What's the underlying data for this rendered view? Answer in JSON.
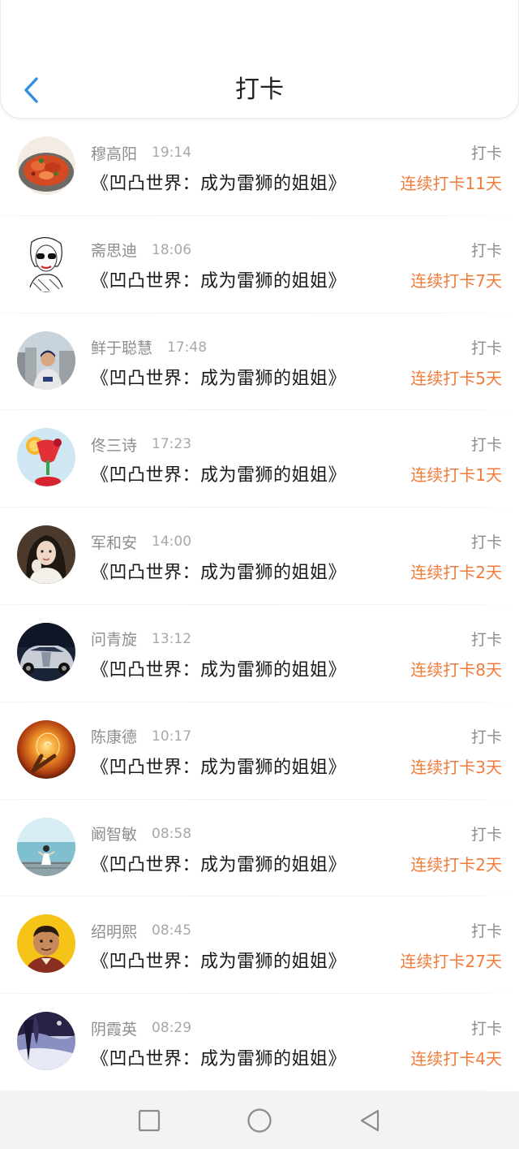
{
  "header": {
    "title": "打卡"
  },
  "icons": {
    "back": "chevron-left-icon",
    "nav_recent": "square-icon",
    "nav_home": "circle-icon",
    "nav_back": "triangle-back-icon"
  },
  "colors": {
    "accent_blue": "#2f8fe6",
    "streak_orange": "#f07b3a",
    "muted_text": "#8d8d8d",
    "title_text": "#1a1a1a"
  },
  "items": [
    {
      "name": "穆高阳",
      "time": "19:14",
      "title": "《凹凸世界：成为雷狮的姐姐》",
      "action": "打卡",
      "streak": "连续打卡11天",
      "avatar": "food-dish"
    },
    {
      "name": "斋思迪",
      "time": "18:06",
      "title": "《凹凸世界：成为雷狮的姐姐》",
      "action": "打卡",
      "streak": "连续打卡7天",
      "avatar": "sketch-girl"
    },
    {
      "name": "鲜于聪慧",
      "time": "17:48",
      "title": "《凹凸世界：成为雷狮的姐姐》",
      "action": "打卡",
      "streak": "连续打卡5天",
      "avatar": "man-city"
    },
    {
      "name": "佟三诗",
      "time": "17:23",
      "title": "《凹凸世界：成为雷狮的姐姐》",
      "action": "打卡",
      "streak": "连续打卡1天",
      "avatar": "cocktail"
    },
    {
      "name": "军和安",
      "time": "14:00",
      "title": "《凹凸世界：成为雷狮的姐姐》",
      "action": "打卡",
      "streak": "连续打卡2天",
      "avatar": "woman-portrait"
    },
    {
      "name": "问青旋",
      "time": "13:12",
      "title": "《凹凸世界：成为雷狮的姐姐》",
      "action": "打卡",
      "streak": "连续打卡8天",
      "avatar": "car"
    },
    {
      "name": "陈康德",
      "time": "10:17",
      "title": "《凹凸世界：成为雷狮的姐姐》",
      "action": "打卡",
      "streak": "连续打卡3天",
      "avatar": "light-bulb"
    },
    {
      "name": "阚智敏",
      "time": "08:58",
      "title": "《凹凸世界：成为雷狮的姐姐》",
      "action": "打卡",
      "streak": "连续打卡2天",
      "avatar": "seaside-girl"
    },
    {
      "name": "绍明熙",
      "time": "08:45",
      "title": "《凹凸世界：成为雷狮的姐姐》",
      "action": "打卡",
      "streak": "连续打卡27天",
      "avatar": "cartoon-man"
    },
    {
      "name": "阴霞英",
      "time": "08:29",
      "title": "《凹凸世界：成为雷狮的姐姐》",
      "action": "打卡",
      "streak": "连续打卡4天",
      "avatar": "night-scene"
    }
  ]
}
